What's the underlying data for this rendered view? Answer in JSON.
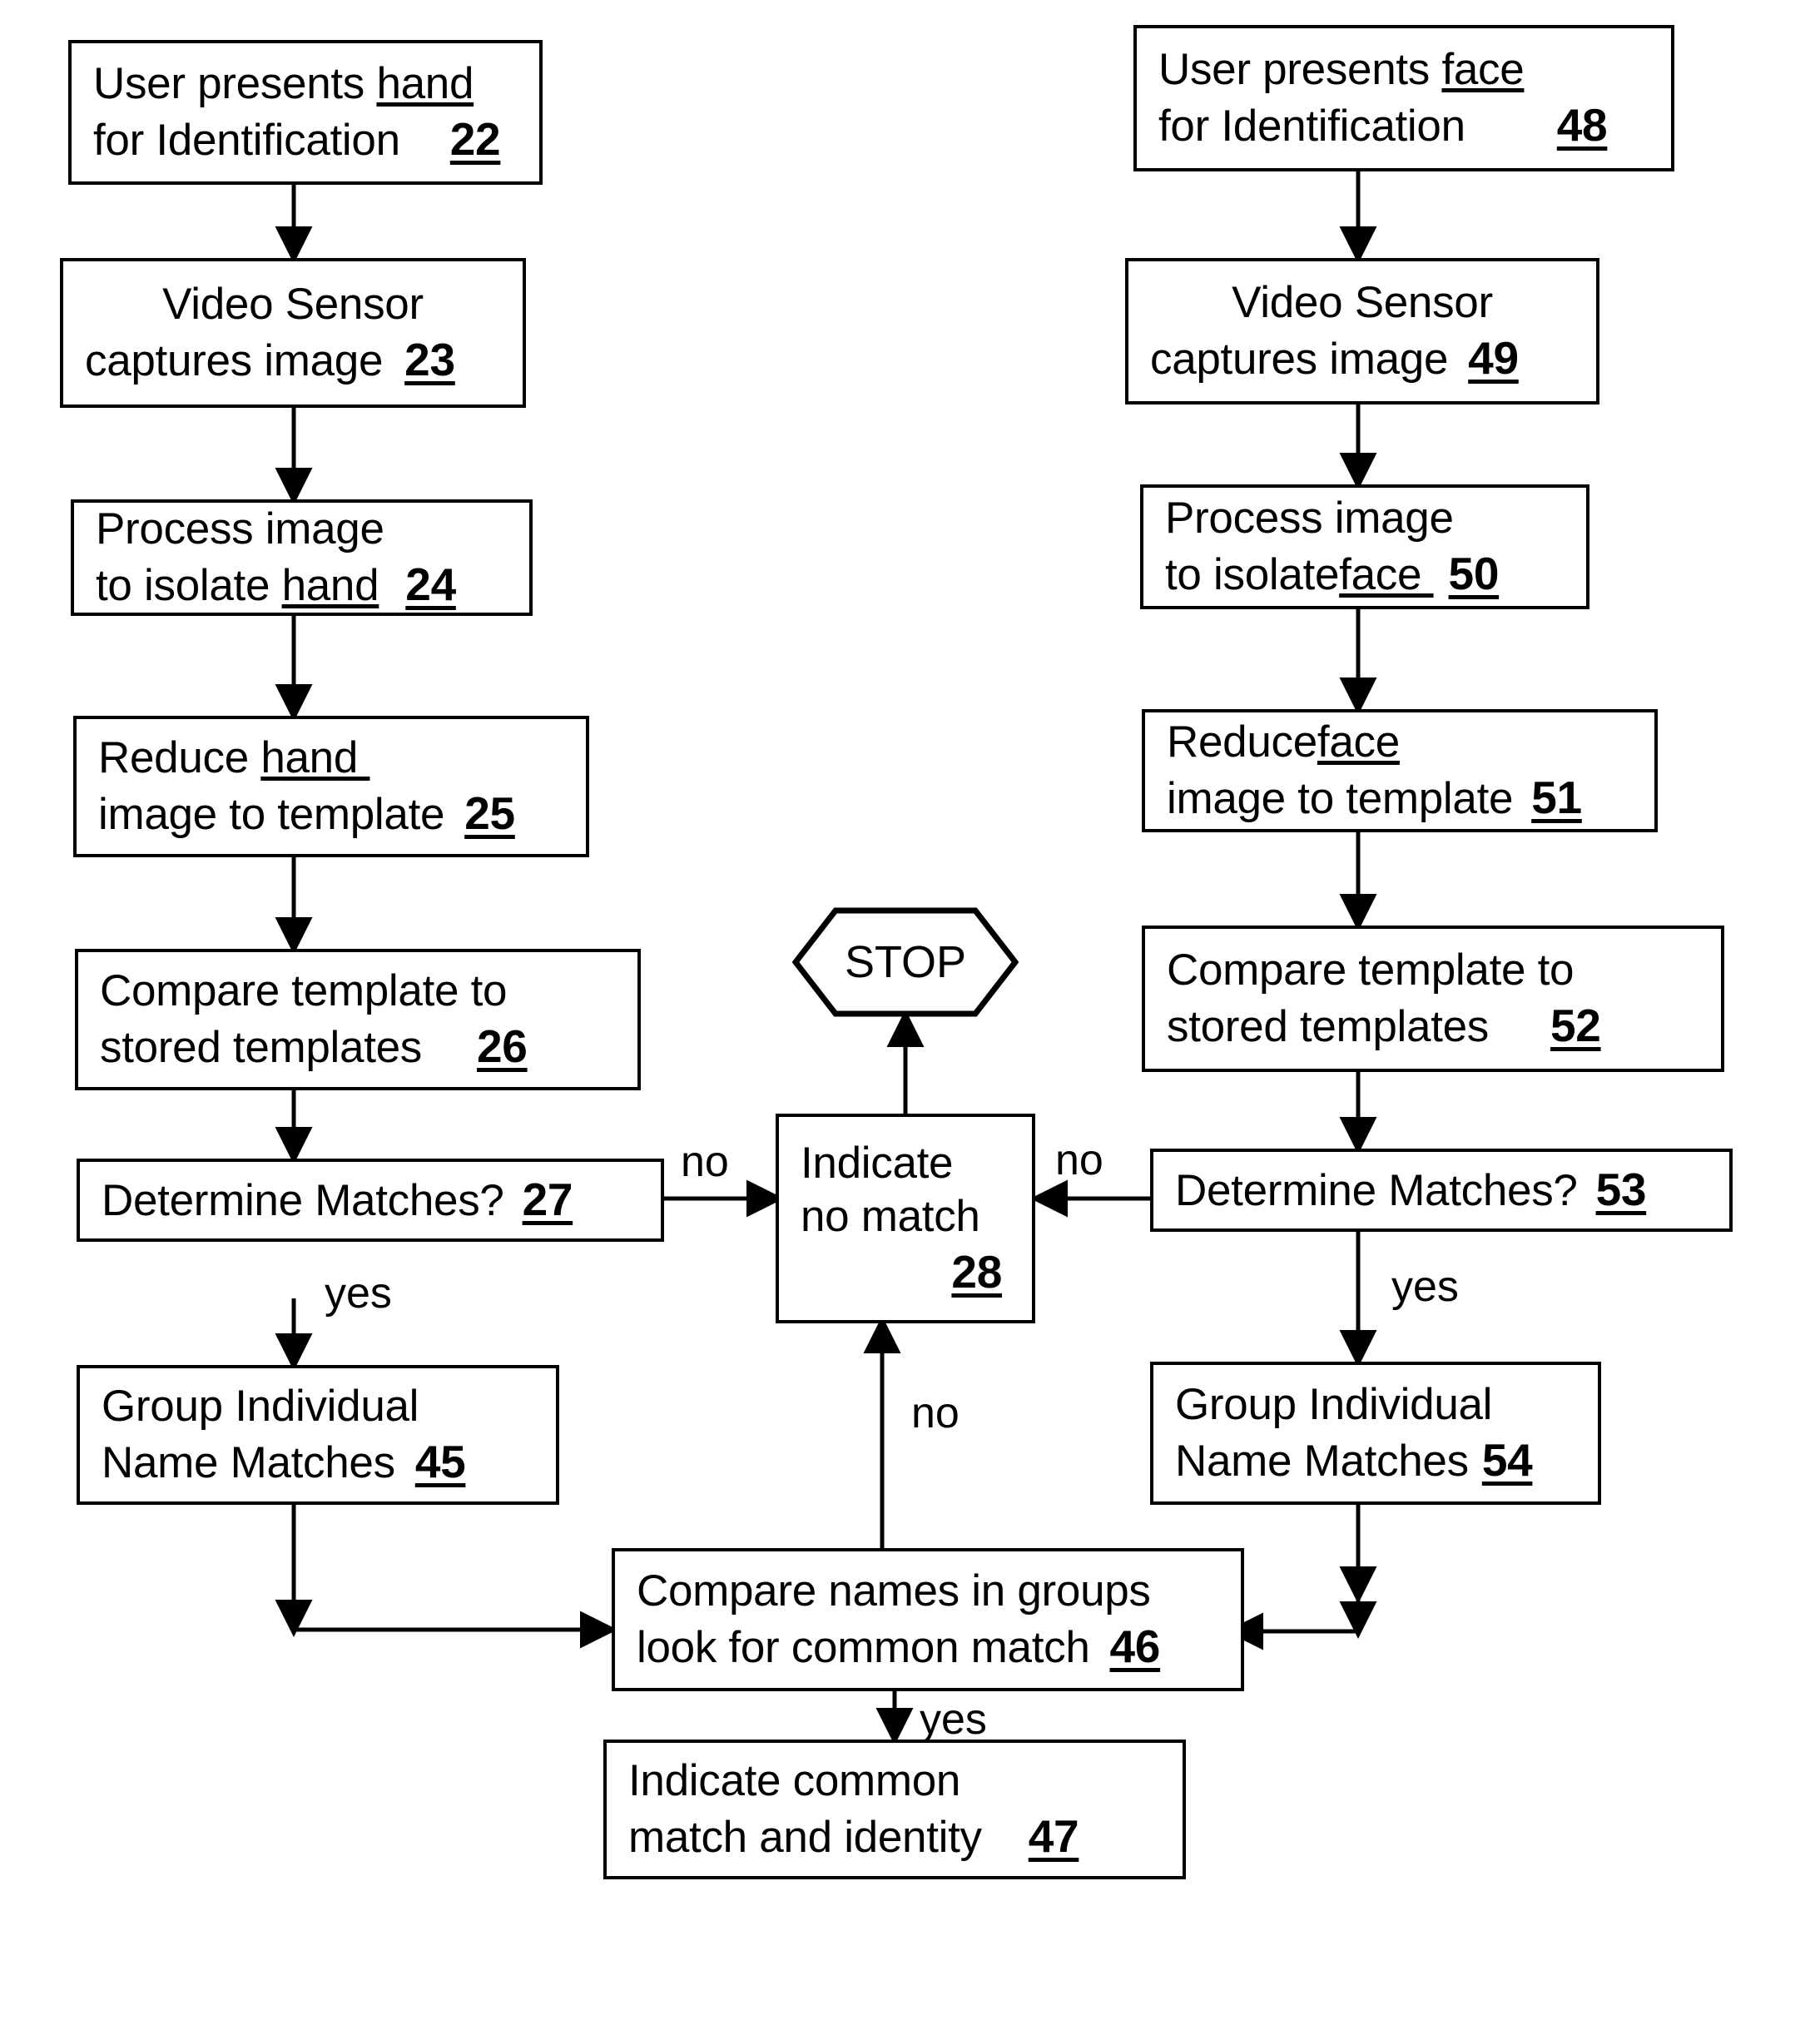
{
  "diagram": {
    "type": "flowchart",
    "title": "Biometric hand and face identification process flow",
    "stroke_color": "#000000",
    "background_color": "#ffffff",
    "nodes": [
      {
        "id": "22",
        "shape": "process",
        "line1_pre": "User presents ",
        "line1_underlined": "hand",
        "line1_post": "",
        "line2_pre": "for Identification",
        "line2_underlined": "",
        "line2_post": "",
        "ref": "22"
      },
      {
        "id": "23",
        "shape": "process",
        "line1_pre": "Video Sensor",
        "line1_underlined": "",
        "line1_post": "",
        "line2_pre": "captures image",
        "line2_underlined": "",
        "line2_post": "",
        "ref": "23"
      },
      {
        "id": "24",
        "shape": "process",
        "line1_pre": "Process image",
        "line1_underlined": "",
        "line1_post": "",
        "line2_pre": "to isolate ",
        "line2_underlined": "hand",
        "line2_post": "",
        "ref": "24"
      },
      {
        "id": "25",
        "shape": "process",
        "line1_pre": "Reduce ",
        "line1_underlined": "hand ",
        "line1_post": "",
        "line2_pre": "image to template",
        "line2_underlined": "",
        "line2_post": "",
        "ref": "25"
      },
      {
        "id": "26",
        "shape": "process",
        "line1_pre": "Compare template to",
        "line1_underlined": "",
        "line1_post": "",
        "line2_pre": "stored templates",
        "line2_underlined": "",
        "line2_post": "",
        "ref": "26"
      },
      {
        "id": "27",
        "shape": "decision",
        "line1_pre": "Determine Matches?",
        "line1_underlined": "",
        "line1_post": "",
        "line2_pre": "",
        "line2_underlined": "",
        "line2_post": "",
        "ref": "27"
      },
      {
        "id": "28",
        "shape": "process",
        "line1_pre": "Indicate",
        "line1_underlined": "",
        "line1_post": "",
        "line2_pre": "no match",
        "line2_underlined": "",
        "line2_post": "",
        "ref": "28"
      },
      {
        "id": "45",
        "shape": "process",
        "line1_pre": "Group Individual",
        "line1_underlined": "",
        "line1_post": "",
        "line2_pre": "Name Matches",
        "line2_underlined": "",
        "line2_post": "",
        "ref": "45"
      },
      {
        "id": "46",
        "shape": "process",
        "line1_pre": "Compare names in groups",
        "line1_underlined": "",
        "line1_post": "",
        "line2_pre": "look for common match",
        "line2_underlined": "",
        "line2_post": "",
        "ref": "46"
      },
      {
        "id": "47",
        "shape": "process",
        "line1_pre": "Indicate common",
        "line1_underlined": "",
        "line1_post": "",
        "line2_pre": "match and identity",
        "line2_underlined": "",
        "line2_post": "",
        "ref": "47"
      },
      {
        "id": "48",
        "shape": "process",
        "line1_pre": "User presents ",
        "line1_underlined": "face",
        "line1_post": "",
        "line2_pre": "for Identification",
        "line2_underlined": "",
        "line2_post": "",
        "ref": "48"
      },
      {
        "id": "49",
        "shape": "process",
        "line1_pre": "Video Sensor",
        "line1_underlined": "",
        "line1_post": "",
        "line2_pre": "captures image",
        "line2_underlined": "",
        "line2_post": "",
        "ref": "49"
      },
      {
        "id": "50",
        "shape": "process",
        "line1_pre": "Process image",
        "line1_underlined": "",
        "line1_post": "",
        "line2_pre": "to isolate",
        "line2_underlined": "face ",
        "line2_post": "",
        "ref": "50"
      },
      {
        "id": "51",
        "shape": "process",
        "line1_pre": "Reduce",
        "line1_underlined": "face",
        "line1_post": "",
        "line2_pre": "image to template",
        "line2_underlined": "",
        "line2_post": "",
        "ref": "51"
      },
      {
        "id": "52",
        "shape": "process",
        "line1_pre": "Compare template to",
        "line1_underlined": "",
        "line1_post": "",
        "line2_pre": "stored templates",
        "line2_underlined": "",
        "line2_post": "",
        "ref": "52"
      },
      {
        "id": "53",
        "shape": "decision",
        "line1_pre": "Determine Matches?",
        "line1_underlined": "",
        "line1_post": "",
        "line2_pre": "",
        "line2_underlined": "",
        "line2_post": "",
        "ref": "53"
      },
      {
        "id": "54",
        "shape": "process",
        "line1_pre": "Group Individual",
        "line1_underlined": "",
        "line1_post": "",
        "line2_pre": "Name Matches",
        "line2_underlined": "",
        "line2_post": "",
        "ref": "54"
      }
    ],
    "terminator": {
      "id": "stop",
      "shape": "hexagon",
      "label": "STOP"
    },
    "edge_labels": {
      "no_left": "no",
      "no_right": "no",
      "no_center": "no",
      "yes_left": "yes",
      "yes_right": "yes",
      "yes_center": "yes"
    }
  }
}
